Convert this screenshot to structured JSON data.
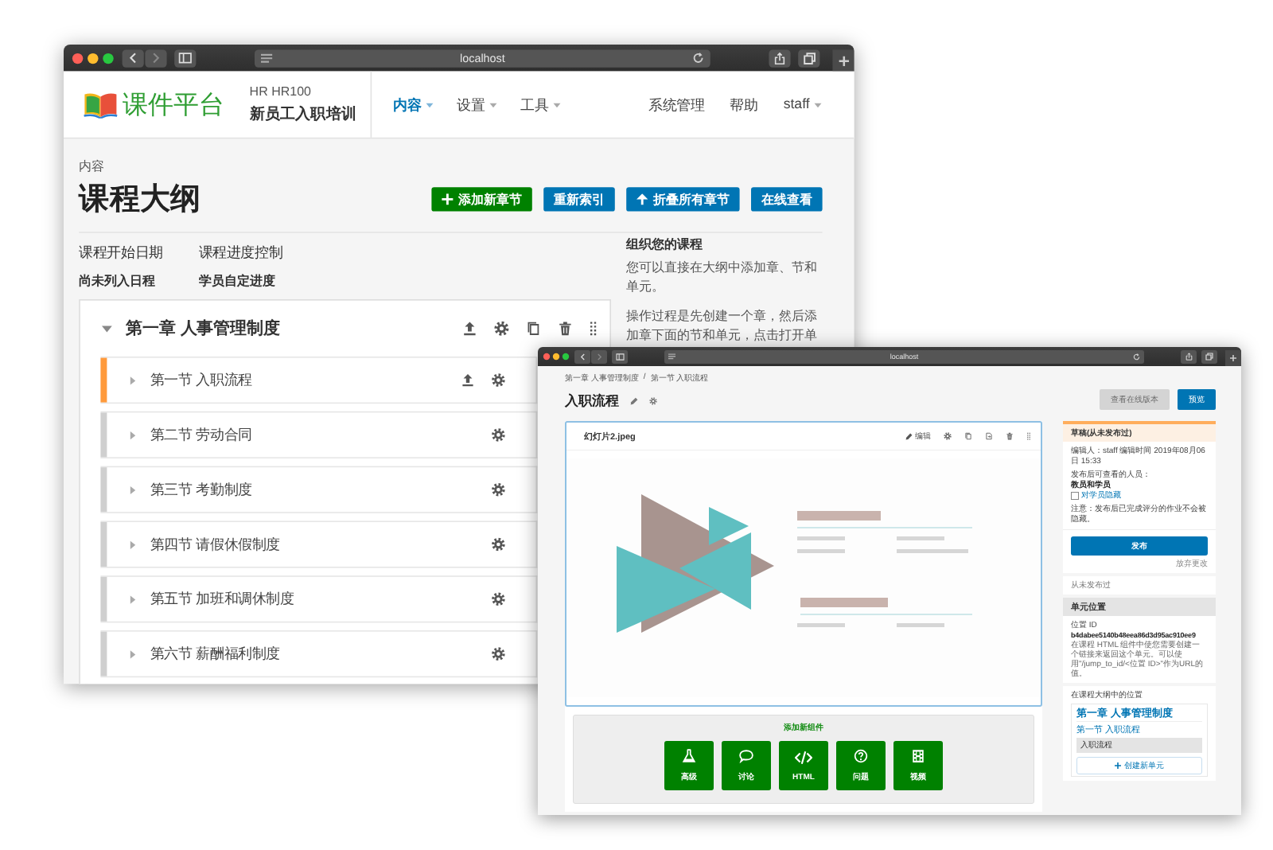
{
  "back_window": {
    "address": "localhost",
    "logo": "课件平台",
    "course_code": "HR HR100",
    "course_name": "新员工入职培训",
    "nav": [
      {
        "label": "内容",
        "selected": true,
        "menu": true
      },
      {
        "label": "设置",
        "selected": false,
        "menu": true
      },
      {
        "label": "工具",
        "selected": false,
        "menu": true
      }
    ],
    "user_nav": [
      {
        "label": "系统管理",
        "menu": false
      },
      {
        "label": "帮助",
        "menu": false
      },
      {
        "label": "staff",
        "menu": true
      }
    ],
    "page_kicker": "内容",
    "page_title": "课程大纲",
    "actions": [
      {
        "label": "添加新章节",
        "kind": "add"
      },
      {
        "label": "重新索引",
        "kind": "plain"
      },
      {
        "label": "折叠所有章节",
        "kind": "collapse"
      },
      {
        "label": "在线查看",
        "kind": "plain"
      }
    ],
    "settings": [
      {
        "label": "课程开始日期",
        "value": "尚未列入日程"
      },
      {
        "label": "课程进度控制",
        "value": "学员自定进度"
      }
    ],
    "help": {
      "title": "组织您的课程",
      "paragraphs": [
        "您可以直接在大纲中添加章、节和单元。",
        "操作过程是先创建一个章，然后添加章下面的节和单元，点击打开单"
      ]
    },
    "chapter": {
      "title": "第一章 人事管理制度",
      "expanded": true,
      "sections": [
        {
          "title": "第一节 入职流程",
          "selected": true,
          "expanded": false
        },
        {
          "title": "第二节 劳动合同",
          "selected": false,
          "expanded": false
        },
        {
          "title": "第三节 考勤制度",
          "selected": false,
          "expanded": false
        },
        {
          "title": "第四节 请假休假制度",
          "selected": false,
          "expanded": false
        },
        {
          "title": "第五节 加班和调休制度",
          "selected": false,
          "expanded": false
        },
        {
          "title": "第六节 薪酬福利制度",
          "selected": false,
          "expanded": false
        }
      ]
    }
  },
  "front_window": {
    "address": "localhost",
    "breadcrumb": [
      "第一章 人事管理制度",
      "第一节 入职流程"
    ],
    "breadcrumb_separator": "/",
    "title": "入职流程",
    "buttons": [
      {
        "label": "查看在线版本",
        "disabled": true
      },
      {
        "label": "预览",
        "disabled": false
      }
    ],
    "component": {
      "title": "幻灯片2.jpeg",
      "edit_label": "编辑"
    },
    "add_component": {
      "title": "添加新组件",
      "types": [
        {
          "label": "高级",
          "kind": "lab"
        },
        {
          "label": "讨论",
          "kind": "discussion"
        },
        {
          "label": "HTML",
          "kind": "html"
        },
        {
          "label": "问题",
          "kind": "problem"
        },
        {
          "label": "视频",
          "kind": "video"
        }
      ]
    },
    "status": {
      "title": "草稿(从未发布过)",
      "edited": "编辑人：staff 编辑时间 2019年08月06日 15:33",
      "visibility_label": "发布后可查看的人员：",
      "visibility": "教员和学员",
      "hide_option": {
        "label": "对学员隐藏",
        "checked": false
      },
      "note": "注意：发布后已完成评分的作业不会被隐藏。",
      "publish": "发布",
      "discard": "放弃更改"
    },
    "release": "从未发布过",
    "location": {
      "title": "单元位置",
      "id_label": "位置 ID",
      "id": "b4dabee5140b48eea86d3d95ac910ee9",
      "hint": "在课程 HTML 组件中使您需要创建一个链接来返回这个单元。可以使用\"/jump_to_id/<位置 ID>\"作为URL的值。"
    },
    "outline": {
      "title": "在课程大纲中的位置",
      "chapter": "第一章 人事管理制度",
      "section": "第一节 入职流程",
      "unit": "入职流程",
      "new_unit": "创建新单元"
    }
  }
}
